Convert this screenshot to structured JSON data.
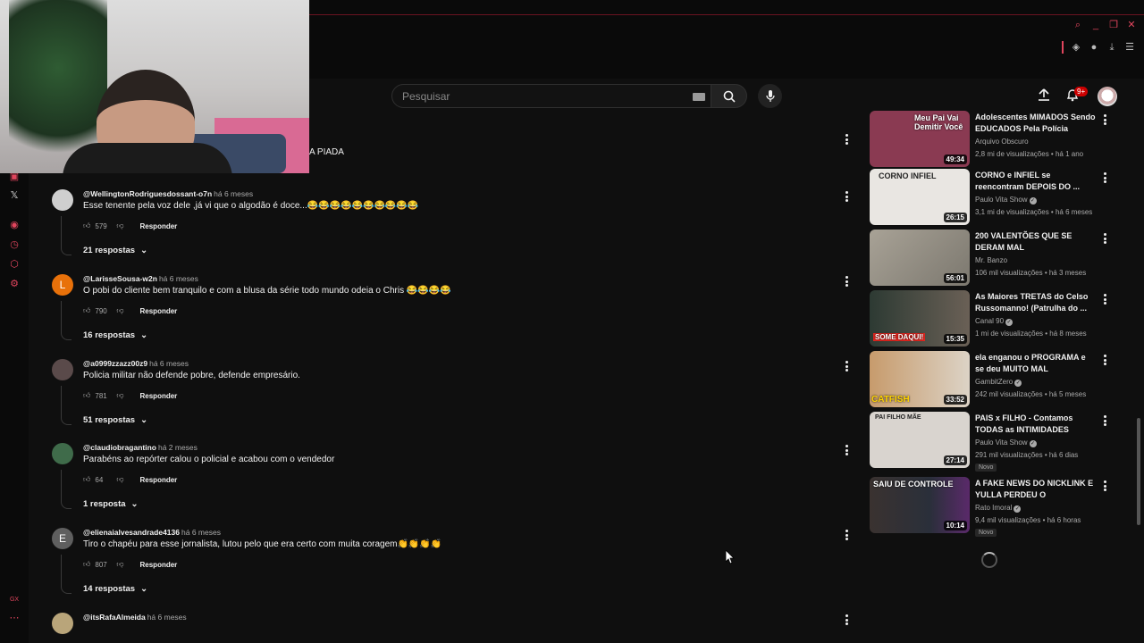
{
  "masthead": {
    "search_placeholder": "Pesquisar",
    "notification_count": "9+"
  },
  "webcam": {
    "caption": "A PIADA"
  },
  "colors": {
    "accent": "#e0455d",
    "youtube_red": "#cc0000",
    "background": "#0f0f0f"
  },
  "comments": [
    {
      "author": "@WellingtonRodriguesdossant-o7n",
      "time": "há 6 meses",
      "text": "Esse tenente pela voz dele ,já vi que o algodão é doce...😂😂😂😂😂😂😂😂😂😂",
      "likes": "579",
      "reply_label": "Responder",
      "replies_label": "21 respostas",
      "avatar_letter": "",
      "avatar_color": "#cfcfcf"
    },
    {
      "author": "@LarisseSousa-w2n",
      "time": "há 6 meses",
      "text": "O pobi do cliente bem tranquilo e com a blusa da série todo mundo odeia o Chris 😂😂😂😂",
      "likes": "790",
      "reply_label": "Responder",
      "replies_label": "16 respostas",
      "avatar_letter": "L",
      "avatar_color": "#e8710a"
    },
    {
      "author": "@a0999zzazz00z9",
      "time": "há 6 meses",
      "text": "Policia militar não defende pobre, defende empresário.",
      "likes": "781",
      "reply_label": "Responder",
      "replies_label": "51 respostas",
      "avatar_letter": "",
      "avatar_color": "#5a4a4a"
    },
    {
      "author": "@claudiobragantino",
      "time": "há 2 meses",
      "text": "Parabéns ao repórter calou o policial e acabou com o vendedor",
      "likes": "64",
      "reply_label": "Responder",
      "replies_label": "1 resposta",
      "avatar_letter": "",
      "avatar_color": "#3f6b4a"
    },
    {
      "author": "@elienaialvesandrade4136",
      "time": "há 6 meses",
      "text": "Tiro o chapéu para esse jornalista, lutou pelo que era certo com muita coragem👏👏👏👏",
      "likes": "807",
      "reply_label": "Responder",
      "replies_label": "14 respostas",
      "avatar_letter": "E",
      "avatar_color": "#5f5f5f"
    },
    {
      "author": "@itsRafaAlmeida",
      "time": "há 6 meses",
      "text": "",
      "likes": "",
      "reply_label": "",
      "replies_label": "",
      "avatar_letter": "",
      "avatar_color": "#b9a57a"
    }
  ],
  "related": [
    {
      "title": "Adolescentes MIMADOS Sendo EDUCADOS Pela Polícia",
      "channel": "Arquivo Obscuro",
      "verified": false,
      "meta": "2,8 mi de visualizações • há 1 ano",
      "duration": "49:34",
      "thumb_text": "Meu Pai Vai Demitir Você",
      "thumb_color": "#8a3a52",
      "is_new": false
    },
    {
      "title": "CORNO e INFIEL se reencontram DEPOIS DO ...",
      "channel": "Paulo Vita Show",
      "verified": true,
      "meta": "3,1 mi de visualizações • há 6 meses",
      "duration": "26:15",
      "thumb_text": "CORNO   INFIEL",
      "thumb_color": "#e9e6e2",
      "is_new": false
    },
    {
      "title": "200 VALENTÕES QUE SE DERAM MAL",
      "channel": "Mr. Banzo",
      "verified": false,
      "meta": "106 mil visualizações • há 3 meses",
      "duration": "56:01",
      "thumb_text": "",
      "thumb_color": "#8f8a80",
      "is_new": false
    },
    {
      "title": "As Maiores TRETAS do Celso Russomanno! (Patrulha do ...",
      "channel": "Canal 90",
      "verified": true,
      "meta": "1 mi de visualizações • há 8 meses",
      "duration": "15:35",
      "thumb_text": "SOME DAQUI!",
      "thumb_color": "#3a4a3e",
      "is_new": false
    },
    {
      "title": "ela enganou o PROGRAMA e se deu MUITO MAL",
      "channel": "GambitZero",
      "verified": true,
      "meta": "242 mil visualizações • há 5 meses",
      "duration": "33:52",
      "thumb_text": "CATFISH",
      "thumb_color": "#c9b08a",
      "is_new": false
    },
    {
      "title": "PAIS x FILHO - Contamos TODAS as INTIMIDADES",
      "channel": "Paulo Vita Show",
      "verified": true,
      "meta": "291 mil visualizações • há 6 dias",
      "duration": "27:14",
      "thumb_text": "PAI   FILHO   MÃE",
      "thumb_color": "#d9d4cf",
      "is_new": true,
      "new_label": "Novo"
    },
    {
      "title": "A FAKE NEWS DO NICKLINK E YULLA PERDEU O CONTROLE....",
      "channel": "Rato Imoral",
      "verified": true,
      "meta": "9,4 mil visualizações • há 6 horas",
      "duration": "10:14",
      "thumb_text": "SAIU DE CONTROLE",
      "thumb_color": "#2a2f3a",
      "is_new": true,
      "new_label": "Novo"
    }
  ]
}
